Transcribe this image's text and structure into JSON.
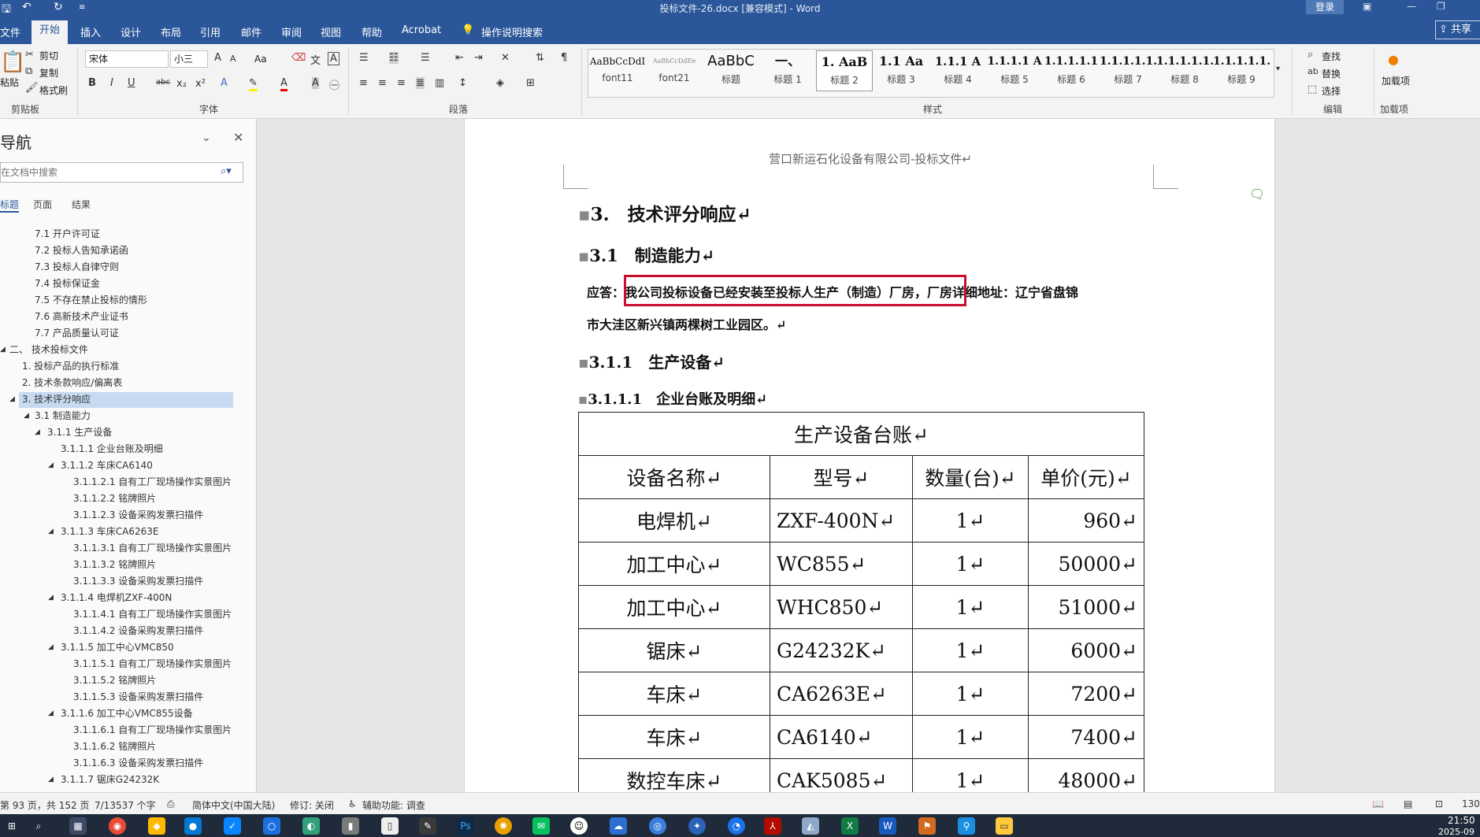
{
  "titlebar": {
    "title": "投标文件-26.docx [兼容模式] - Word",
    "login": "登录",
    "save_icon": "save-icon",
    "undo_icon": "undo-icon",
    "redo_icon": "redo-icon"
  },
  "tabs": [
    "文件",
    "开始",
    "插入",
    "设计",
    "布局",
    "引用",
    "邮件",
    "审阅",
    "视图",
    "帮助",
    "Acrobat",
    "操作说明搜索"
  ],
  "active_tab": "开始",
  "share": "共享",
  "ribbon": {
    "clipboard": {
      "paste": "粘贴",
      "cut": "剪切",
      "copy": "复制",
      "format_painter": "格式刷",
      "label": "剪贴板"
    },
    "font": {
      "name": "宋体",
      "size": "小三",
      "label": "字体",
      "case": "Aa"
    },
    "paragraph": {
      "label": "段落"
    },
    "styles": {
      "label": "样式",
      "items": [
        {
          "sample": "AaBbCcDdI",
          "name": "font11"
        },
        {
          "sample": "AaBbCcDdEe",
          "name": "font21"
        },
        {
          "sample": "AaBbC",
          "name": "标题"
        },
        {
          "sample": "一、",
          "name": "标题 1"
        },
        {
          "sample": "1. AaB",
          "name": "标题 2"
        },
        {
          "sample": "1.1 Aa",
          "name": "标题 3"
        },
        {
          "sample": "1.1.1 A",
          "name": "标题 4"
        },
        {
          "sample": "1.1.1.1 A",
          "name": "标题 5"
        },
        {
          "sample": "1.1.1.1.1",
          "name": "标题 6"
        },
        {
          "sample": "1.1.1.1.1.",
          "name": "标题 7"
        },
        {
          "sample": "1.1.1.1.1.1",
          "name": "标题 8"
        },
        {
          "sample": "1.1.1.1.1.1",
          "name": "标题 9"
        }
      ]
    },
    "editing": {
      "find": "查找",
      "replace": "替换",
      "select": "选择",
      "label": "编辑"
    },
    "addins": {
      "label": "加载项",
      "button": "加载项"
    }
  },
  "nav": {
    "title": "导航",
    "search_placeholder": "在文档中搜索",
    "tabs": [
      "标题",
      "页面",
      "结果"
    ],
    "items": [
      {
        "text": "7.1 开户许可证"
      },
      {
        "text": "7.2 投标人告知承诺函"
      },
      {
        "text": "7.3 投标人自律守则"
      },
      {
        "text": "7.4 投标保证金"
      },
      {
        "text": "7.5 不存在禁止投标的情形"
      },
      {
        "text": "7.6 高新技术产业证书"
      },
      {
        "text": "7.7 产品质量认可证"
      },
      {
        "text": "二、 技术投标文件"
      },
      {
        "text": "1. 投标产品的执行标准"
      },
      {
        "text": "2. 技术条款响应/偏离表"
      },
      {
        "text": "3. 技术评分响应"
      },
      {
        "text": "3.1 制造能力"
      },
      {
        "text": "3.1.1 生产设备"
      },
      {
        "text": "3.1.1.1 企业台账及明细"
      },
      {
        "text": "3.1.1.2 车床CA6140"
      },
      {
        "text": "3.1.1.2.1 自有工厂现场操作实景图片"
      },
      {
        "text": "3.1.1.2.2 铭牌照片"
      },
      {
        "text": "3.1.1.2.3 设备采购发票扫描件"
      },
      {
        "text": "3.1.1.3 车床CA6263E"
      },
      {
        "text": "3.1.1.3.1 自有工厂现场操作实景图片"
      },
      {
        "text": "3.1.1.3.2 铭牌照片"
      },
      {
        "text": "3.1.1.3.3 设备采购发票扫描件"
      },
      {
        "text": "3.1.1.4 电焊机ZXF-400N"
      },
      {
        "text": "3.1.1.4.1 自有工厂现场操作实景图片"
      },
      {
        "text": "3.1.1.4.2 设备采购发票扫描件"
      },
      {
        "text": "3.1.1.5 加工中心VMC850"
      },
      {
        "text": "3.1.1.5.1 自有工厂现场操作实景图片"
      },
      {
        "text": "3.1.1.5.2 铭牌照片"
      },
      {
        "text": "3.1.1.5.3 设备采购发票扫描件"
      },
      {
        "text": "3.1.1.6 加工中心VMC855设备"
      },
      {
        "text": "3.1.1.6.1 自有工厂现场操作实景图片"
      },
      {
        "text": "3.1.1.6.2 铭牌照片"
      },
      {
        "text": "3.1.1.6.3 设备采购发票扫描件"
      },
      {
        "text": "3.1.1.7 锯床G24232K"
      }
    ]
  },
  "doc": {
    "header": "营口新运石化设备有限公司-投标文件↵",
    "h1": "3.　技术评分响应↵",
    "h2": "3.1　制造能力↵",
    "answer_label": "应答：",
    "answer_highlight": "我公司投标设备已经安装至投标人生产（制造）厂房",
    "answer_rest": "，厂房详细地址：辽宁省盘锦",
    "answer_line2": "市大洼区新兴镇两棵树工业园区。↵",
    "h3": "3.1.1　生产设备↵",
    "h4": "3.1.1.1　企业台账及明细↵",
    "table": {
      "caption": "生产设备台账↵",
      "headers": [
        "设备名称↵",
        "型号↵",
        "数量(台)↵",
        "单价(元)↵"
      ],
      "rows": [
        [
          "电焊机↵",
          "ZXF-400N↵",
          "1↵",
          "960↵"
        ],
        [
          "加工中心↵",
          "WC855↵",
          "1↵",
          "50000↵"
        ],
        [
          "加工中心↵",
          "WHC850↵",
          "1↵",
          "51000↵"
        ],
        [
          "锯床↵",
          "G24232K↵",
          "1↵",
          "6000↵"
        ],
        [
          "车床↵",
          "CA6263E↵",
          "1↵",
          "7200↵"
        ],
        [
          "车床↵",
          "CA6140↵",
          "1↵",
          "7400↵"
        ],
        [
          "数控车床↵",
          "CAK5085↵",
          "1↵",
          "48000↵"
        ]
      ]
    }
  },
  "status": {
    "page": "第 93 页，共 152 页",
    "words": "7/13537 个字",
    "lang": "简体中文(中国大陆)",
    "track": "修订: 关闭",
    "access": "辅助功能: 调查",
    "zoom": "130"
  },
  "taskbar": {
    "time": "21:50",
    "date": "2025-09"
  }
}
